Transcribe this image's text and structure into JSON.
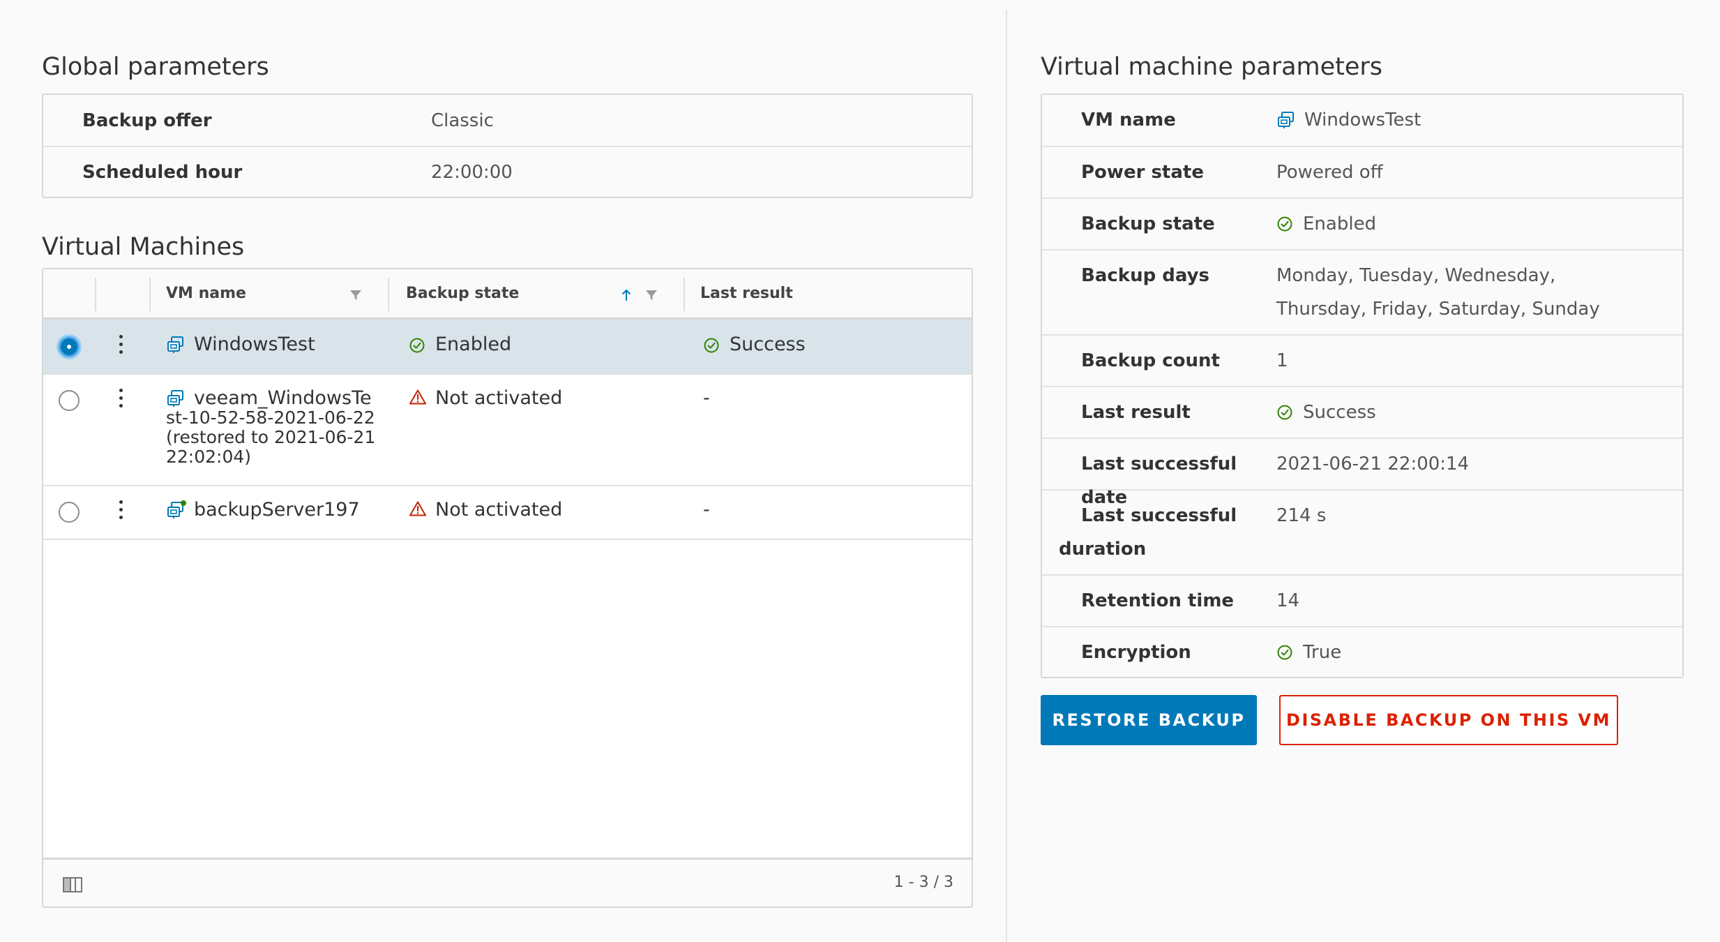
{
  "global": {
    "title": "Global parameters",
    "rows": [
      {
        "label": "Backup offer",
        "value": "Classic"
      },
      {
        "label": "Scheduled hour",
        "value": "22:00:00"
      }
    ]
  },
  "vms": {
    "title": "Virtual Machines",
    "columns": {
      "vm_name": "VM name",
      "backup_state": "Backup state",
      "last_result": "Last result"
    },
    "rows": [
      {
        "name": "WindowsTest",
        "backup_state": "Enabled",
        "last_result": "Success",
        "selected": true
      },
      {
        "name": "veeam_WindowsTest-10-52-58-2021-06-22 (restored to 2021-06-21 22:02:04)",
        "name_lines": [
          "veeam_WindowsTe",
          "st-10-52-58-2021-06-22",
          "(restored to 2021-06-21",
          "22:02:04)"
        ],
        "backup_state": "Not activated",
        "last_result": "-",
        "selected": false
      },
      {
        "name": "backupServer197",
        "backup_state": "Not activated",
        "last_result": "-",
        "selected": false
      }
    ],
    "pagination": "1 - 3 / 3"
  },
  "vm_params": {
    "title": "Virtual machine parameters",
    "rows": [
      {
        "label": "VM name",
        "value": "WindowsTest"
      },
      {
        "label": "Power state",
        "value": "Powered off"
      },
      {
        "label": "Backup state",
        "value": "Enabled"
      },
      {
        "label": "Backup days",
        "value": "Monday, Tuesday, Wednesday, Thursday, Friday, Saturday, Sunday"
      },
      {
        "label": "Backup count",
        "value": "1"
      },
      {
        "label": "Last result",
        "value": "Success"
      },
      {
        "label": "Last successful date",
        "value": "2021-06-21 22:00:14"
      },
      {
        "label": "Last successful duration",
        "value": "214 s"
      },
      {
        "label": "Retention time",
        "value": "14"
      },
      {
        "label": "Encryption",
        "value": "True"
      }
    ]
  },
  "actions": {
    "restore": "RESTORE BACKUP",
    "disable": "DISABLE BACKUP ON THIS VM"
  },
  "colors": {
    "accent": "#0079b8",
    "danger": "#db2100",
    "success": "#2f8400",
    "warning": "#c92100"
  },
  "icons": [
    "vm-icon",
    "success-check-icon",
    "warning-triangle-icon",
    "filter-icon",
    "sort-ascending-icon",
    "kebab-menu-icon",
    "column-toggle-icon"
  ]
}
